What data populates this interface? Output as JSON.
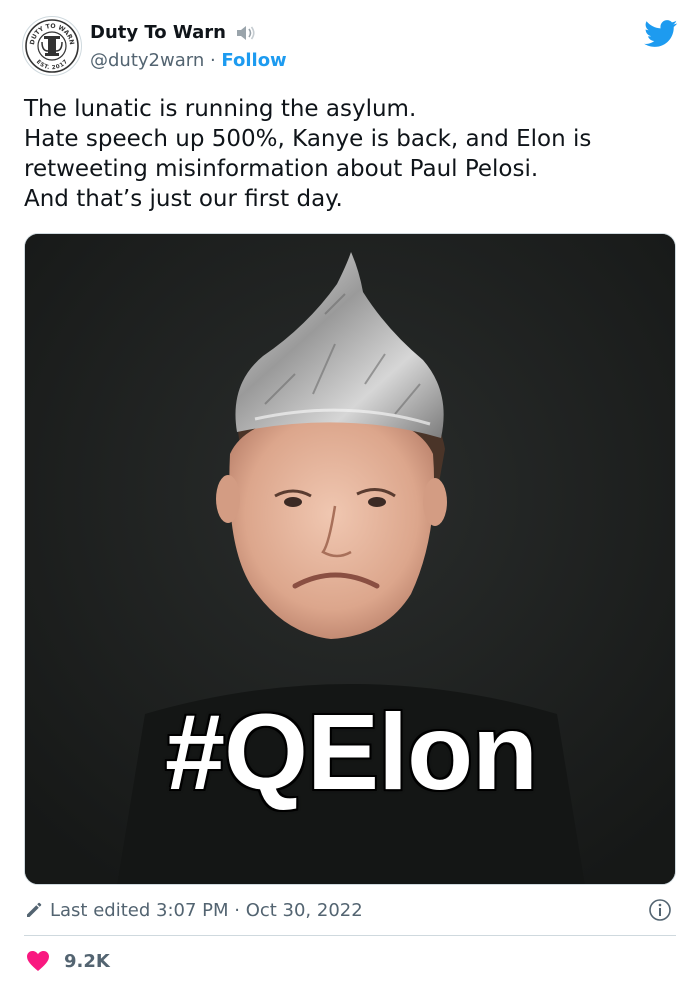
{
  "author": {
    "display_name": "Duty To Warn",
    "handle": "@duty2warn",
    "separator": " · ",
    "follow_label": "Follow",
    "avatar_top_text": "DUTY TO WARN",
    "avatar_bottom_text": "EST. 2017"
  },
  "tweet": {
    "lines": [
      "The lunatic is running the asylum.",
      "Hate speech up 500%, Kanye is back, and Elon is",
      "retweeting misinformation about Paul Pelosi.",
      "And that’s just our first day."
    ]
  },
  "media": {
    "overlay_text": "#QElon"
  },
  "meta": {
    "edited_text": "Last edited 3:07 PM · Oct 30, 2022"
  },
  "engagement": {
    "likes": "9.2K"
  },
  "colors": {
    "accent": "#1d9bf0",
    "heart": "#f91880",
    "muted": "#536471"
  },
  "icons": {
    "bird": "twitter-bird-icon",
    "speaker": "speaker-icon",
    "pencil": "pencil-icon",
    "info": "info-icon",
    "heart": "heart-icon"
  }
}
